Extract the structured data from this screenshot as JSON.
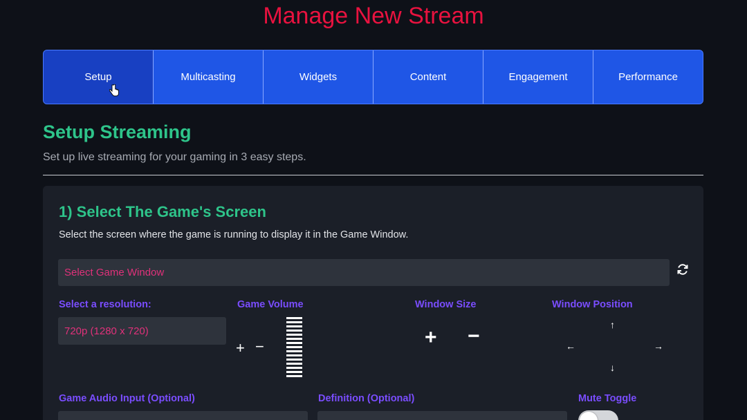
{
  "page": {
    "title": "Manage New Stream"
  },
  "tabs": [
    {
      "label": "Setup",
      "active": true
    },
    {
      "label": "Multicasting"
    },
    {
      "label": "Widgets"
    },
    {
      "label": "Content"
    },
    {
      "label": "Engagement"
    },
    {
      "label": "Performance"
    }
  ],
  "setup": {
    "title": "Setup Streaming",
    "subtitle": "Set up live streaming for your gaming in 3 easy steps."
  },
  "step1": {
    "title": "1) Select The Game's Screen",
    "description": "Select the screen where the game is running to display it in the Game Window.",
    "game_window_placeholder": "Select Game Window",
    "resolution_label": "Select a resolution:",
    "resolution_value": "720p (1280 x 720)",
    "volume_label": "Game Volume",
    "volume_plus": "+",
    "volume_minus": "−",
    "window_size_label": "Window Size",
    "size_plus": "+",
    "size_minus": "−",
    "window_position_label": "Window Position",
    "arrow_up": "↑",
    "arrow_down": "↓",
    "arrow_left": "←",
    "arrow_right": "→",
    "audio_input_label": "Game Audio Input (Optional)",
    "definition_label": "Definition (Optional)",
    "mute_toggle_label": "Mute Toggle"
  },
  "colors": {
    "accent_red": "#e8123f",
    "accent_green": "#2ec48a",
    "accent_purple": "#7a4dff",
    "tab_blue": "#1f56e6",
    "tab_active": "#1840c2",
    "select_text": "#e0317a"
  },
  "icons": {
    "refresh": "refresh-icon",
    "cursor": "pointer-cursor-icon"
  }
}
